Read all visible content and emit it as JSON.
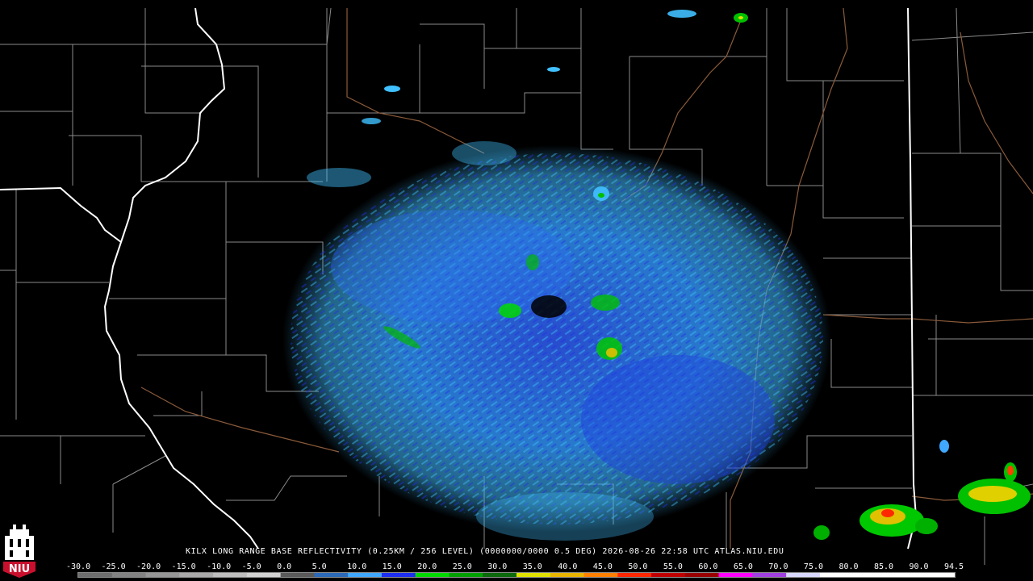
{
  "product_title": "KILX LONG RANGE BASE REFLECTIVITY (0.25KM / 256 LEVEL) (0000000/0000 0.5 DEG) 2026-08-26 22:58 UTC  ATLAS.NIU.EDU",
  "logo_text": "NIU",
  "scale": {
    "labels": [
      "-30.0",
      "-25.0",
      "-20.0",
      "-15.0",
      "-10.0",
      "-5.0",
      "0.0",
      "5.0",
      "10.0",
      "15.0",
      "20.0",
      "25.0",
      "30.0",
      "35.0",
      "40.0",
      "45.0",
      "50.0",
      "55.0",
      "60.0",
      "65.0",
      "70.0",
      "75.0",
      "80.0",
      "85.0",
      "90.0",
      "94.5"
    ],
    "colors": [
      "#6e6e6e",
      "#828282",
      "#969696",
      "#aaaaaa",
      "#bebebe",
      "#d2d2d2",
      "#5a5a5a",
      "#2c6ab8",
      "#40a8ff",
      "#1f2ff0",
      "#00d800",
      "#00a000",
      "#0c6a0c",
      "#e0e000",
      "#e8b400",
      "#ff8000",
      "#ff2800",
      "#c00000",
      "#9a0000",
      "#ff00ff",
      "#a040e0",
      "#d8d8ff",
      "#ffffff",
      "#ffffff",
      "#ffffff",
      "#ffffff"
    ]
  },
  "colors": {
    "background": "#000000",
    "county_lines": "#8a8a8a",
    "state_lines": "#ffffff",
    "rivers": "#8a5a3a"
  }
}
